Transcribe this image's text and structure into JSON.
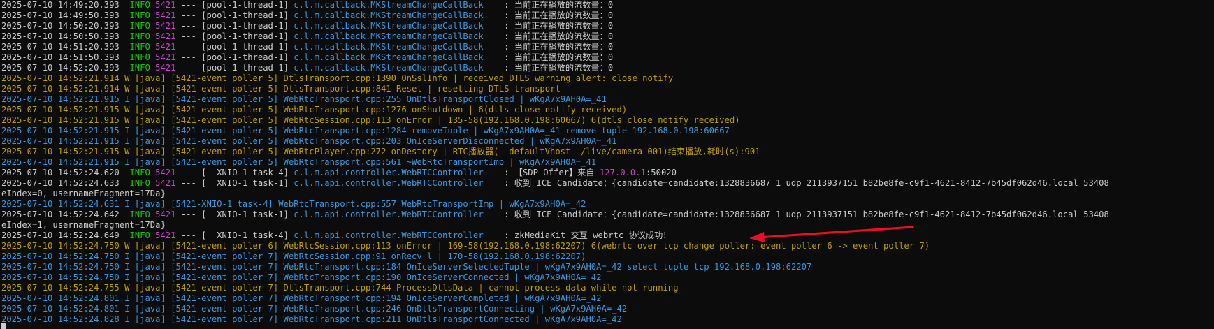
{
  "colors": {
    "background": "#0c0c0c",
    "default": "#cccccc",
    "timestamp": "#cccccc",
    "info": "#16c60c",
    "pid": "#c846c8",
    "thread": "#cccccc",
    "logger": "#3a96dd",
    "message": "#cccccc",
    "warn_line": "#c19c00",
    "info_line": "#3a96dd",
    "ip": "#c846c8",
    "arrow": "#e81123"
  },
  "lines": [
    [
      {
        "t": "2025-07-10 14:49:20.393  ",
        "c": "timestamp"
      },
      {
        "t": "INFO ",
        "c": "info"
      },
      {
        "t": "5421",
        "c": "pid"
      },
      {
        "t": " --- [pool-1-thread-1] ",
        "c": "thread"
      },
      {
        "t": "c.l.m.callback.MKStreamChangeCallBack    ",
        "c": "logger"
      },
      {
        "t": ": 当前正在播放的流数量：0",
        "c": "message"
      }
    ],
    [
      {
        "t": "2025-07-10 14:49:50.393  ",
        "c": "timestamp"
      },
      {
        "t": "INFO ",
        "c": "info"
      },
      {
        "t": "5421",
        "c": "pid"
      },
      {
        "t": " --- [pool-1-thread-1] ",
        "c": "thread"
      },
      {
        "t": "c.l.m.callback.MKStreamChangeCallBack    ",
        "c": "logger"
      },
      {
        "t": ": 当前正在播放的流数量：0",
        "c": "message"
      }
    ],
    [
      {
        "t": "2025-07-10 14:50:20.393  ",
        "c": "timestamp"
      },
      {
        "t": "INFO ",
        "c": "info"
      },
      {
        "t": "5421",
        "c": "pid"
      },
      {
        "t": " --- [pool-1-thread-1] ",
        "c": "thread"
      },
      {
        "t": "c.l.m.callback.MKStreamChangeCallBack    ",
        "c": "logger"
      },
      {
        "t": ": 当前正在播放的流数量：0",
        "c": "message"
      }
    ],
    [
      {
        "t": "2025-07-10 14:50:50.393  ",
        "c": "timestamp"
      },
      {
        "t": "INFO ",
        "c": "info"
      },
      {
        "t": "5421",
        "c": "pid"
      },
      {
        "t": " --- [pool-1-thread-1] ",
        "c": "thread"
      },
      {
        "t": "c.l.m.callback.MKStreamChangeCallBack    ",
        "c": "logger"
      },
      {
        "t": ": 当前正在播放的流数量：0",
        "c": "message"
      }
    ],
    [
      {
        "t": "2025-07-10 14:51:20.393  ",
        "c": "timestamp"
      },
      {
        "t": "INFO ",
        "c": "info"
      },
      {
        "t": "5421",
        "c": "pid"
      },
      {
        "t": " --- [pool-1-thread-1] ",
        "c": "thread"
      },
      {
        "t": "c.l.m.callback.MKStreamChangeCallBack    ",
        "c": "logger"
      },
      {
        "t": ": 当前正在播放的流数量：0",
        "c": "message"
      }
    ],
    [
      {
        "t": "2025-07-10 14:51:50.393  ",
        "c": "timestamp"
      },
      {
        "t": "INFO ",
        "c": "info"
      },
      {
        "t": "5421",
        "c": "pid"
      },
      {
        "t": " --- [pool-1-thread-1] ",
        "c": "thread"
      },
      {
        "t": "c.l.m.callback.MKStreamChangeCallBack    ",
        "c": "logger"
      },
      {
        "t": ": 当前正在播放的流数量：0",
        "c": "message"
      }
    ],
    [
      {
        "t": "2025-07-10 14:52:20.393  ",
        "c": "timestamp"
      },
      {
        "t": "INFO ",
        "c": "info"
      },
      {
        "t": "5421",
        "c": "pid"
      },
      {
        "t": " --- [pool-1-thread-1] ",
        "c": "thread"
      },
      {
        "t": "c.l.m.callback.MKStreamChangeCallBack    ",
        "c": "logger"
      },
      {
        "t": ": 当前正在播放的流数量：0",
        "c": "message"
      }
    ],
    [
      {
        "t": "2025-07-10 14:52:21.914 W [java] [5421-event poller 5] DtlsTransport.cpp:1390 OnSslInfo | received DTLS warning alert: close notify",
        "c": "warn_line"
      }
    ],
    [
      {
        "t": "2025-07-10 14:52:21.914 W [java] [5421-event poller 5] DtlsTransport.cpp:841 Reset | resetting DTLS transport",
        "c": "warn_line"
      }
    ],
    [
      {
        "t": "2025-07-10 14:52:21.915 I [java] [5421-event poller 5] WebRtcTransport.cpp:255 OnDtlsTransportClosed | wKgA7x9AH0A=_41",
        "c": "info_line"
      }
    ],
    [
      {
        "t": "2025-07-10 14:52:21.915 W [java] [5421-event poller 5] WebRtcTransport.cpp:1276 onShutdown | 6(dtls close notify received)",
        "c": "warn_line"
      }
    ],
    [
      {
        "t": "2025-07-10 14:52:21.915 W [java] [5421-event poller 5] WebRtcSession.cpp:113 onError | 135-58(192.168.0.198:60667) 6(dtls close notify received)",
        "c": "warn_line"
      }
    ],
    [
      {
        "t": "2025-07-10 14:52:21.915 I [java] [5421-event poller 5] WebRtcTransport.cpp:1284 removeTuple | wKgA7x9AH0A=_41 remove tuple 192.168.0.198:60667",
        "c": "info_line"
      }
    ],
    [
      {
        "t": "2025-07-10 14:52:21.915 I [java] [5421-event poller 5] WebRtcTransport.cpp:203 OnIceServerDisconnected | wKgA7x9AH0A=_41",
        "c": "info_line"
      }
    ],
    [
      {
        "t": "2025-07-10 14:52:21.915 W [java] [5421-event poller 5] WebRtcPlayer.cpp:272 onDestory | RTC播放器(__defaultVhost__/live/camera_001)结束播放,耗时(s):901",
        "c": "warn_line"
      }
    ],
    [
      {
        "t": "2025-07-10 14:52:21.915 I [java] [5421-event poller 5] WebRtcTransport.cpp:561 ~WebRtcTransportImp | wKgA7x9AH0A=_41",
        "c": "info_line"
      }
    ],
    [
      {
        "t": "2025-07-10 14:52:24.620  ",
        "c": "timestamp"
      },
      {
        "t": "INFO ",
        "c": "info"
      },
      {
        "t": "5421",
        "c": "pid"
      },
      {
        "t": " --- [  XNIO-1 task-4] ",
        "c": "thread"
      },
      {
        "t": "c.l.m.api.controller.WebRTCController    ",
        "c": "logger"
      },
      {
        "t": ": 【SDP Offer】来自 ",
        "c": "message"
      },
      {
        "t": "127.0.0.1",
        "c": "ip"
      },
      {
        "t": ":50020",
        "c": "message"
      }
    ],
    [
      {
        "t": "2025-07-10 14:52:24.633  ",
        "c": "timestamp"
      },
      {
        "t": "INFO ",
        "c": "info"
      },
      {
        "t": "5421",
        "c": "pid"
      },
      {
        "t": " --- [  XNIO-1 task-1] ",
        "c": "thread"
      },
      {
        "t": "c.l.m.api.controller.WebRTCController    ",
        "c": "logger"
      },
      {
        "t": ": 收到 ICE Candidate：{candidate=candidate:1328836687 1 udp 2113937151 b82be8fe-c9f1-4621-8412-7b45df062d46.local 53408",
        "c": "message"
      }
    ],
    [
      {
        "t": "eIndex=0, usernameFragment=17Da}",
        "c": "message"
      }
    ],
    [
      {
        "t": "2025-07-10 14:52:24.631 I [java] [5421-XNIO-1 task-4] WebRtcTransport.cpp:557 WebRtcTransportImp | wKgA7x9AH0A=_42",
        "c": "info_line"
      }
    ],
    [
      {
        "t": "2025-07-10 14:52:24.642  ",
        "c": "timestamp"
      },
      {
        "t": "INFO ",
        "c": "info"
      },
      {
        "t": "5421",
        "c": "pid"
      },
      {
        "t": " --- [  XNIO-1 task-1] ",
        "c": "thread"
      },
      {
        "t": "c.l.m.api.controller.WebRTCController    ",
        "c": "logger"
      },
      {
        "t": ": 收到 ICE Candidate：{candidate=candidate:1328836687 1 udp 2113937151 b82be8fe-c9f1-4621-8412-7b45df062d46.local 53408",
        "c": "message"
      }
    ],
    [
      {
        "t": "eIndex=1, usernameFragment=17Da}",
        "c": "message"
      }
    ],
    [
      {
        "t": "2025-07-10 14:52:24.649  ",
        "c": "timestamp"
      },
      {
        "t": "INFO ",
        "c": "info"
      },
      {
        "t": "5421",
        "c": "pid"
      },
      {
        "t": " --- [  XNIO-1 task-4] ",
        "c": "thread"
      },
      {
        "t": "c.l.m.api.controller.WebRTCController    ",
        "c": "logger"
      },
      {
        "t": ": zkMediaKit 交互 webrtc 协议成功！",
        "c": "message"
      }
    ],
    [
      {
        "t": "2025-07-10 14:52:24.750 W [java] [5421-event poller 6] WebRtcSession.cpp:113 onError | 169-58(192.168.0.198:62207) 6(webrtc over tcp change poller: event poller 6 -> event poller 7)",
        "c": "warn_line"
      }
    ],
    [
      {
        "t": "2025-07-10 14:52:24.750 I [java] [5421-event poller 7] WebRtcSession.cpp:91 onRecv_l | 170-58(192.168.0.198:62207)",
        "c": "info_line"
      }
    ],
    [
      {
        "t": "2025-07-10 14:52:24.750 I [java] [5421-event poller 7] WebRtcTransport.cpp:184 OnIceServerSelectedTuple | wKgA7x9AH0A=_42 select tuple tcp 192.168.0.198:62207",
        "c": "info_line"
      }
    ],
    [
      {
        "t": "2025-07-10 14:52:24.750 I [java] [5421-event poller 7] WebRtcTransport.cpp:190 OnIceServerConnected | wKgA7x9AH0A=_42",
        "c": "info_line"
      }
    ],
    [
      {
        "t": "2025-07-10 14:52:24.755 W [java] [5421-event poller 7] DtlsTransport.cpp:744 ProcessDtlsData | cannot process data while not running",
        "c": "warn_line"
      }
    ],
    [
      {
        "t": "2025-07-10 14:52:24.801 I [java] [5421-event poller 7] WebRtcTransport.cpp:194 OnIceServerCompleted | wKgA7x9AH0A=_42",
        "c": "info_line"
      }
    ],
    [
      {
        "t": "2025-07-10 14:52:24.801 I [java] [5421-event poller 7] WebRtcTransport.cpp:246 OnDtlsTransportConnecting | wKgA7x9AH0A=_42",
        "c": "info_line"
      }
    ],
    [
      {
        "t": "2025-07-10 14:52:24.828 I [java] [5421-event poller 7] WebRtcTransport.cpp:211 OnDtlsTransportConnected | wKgA7x9AH0A=_42",
        "c": "info_line"
      }
    ]
  ]
}
